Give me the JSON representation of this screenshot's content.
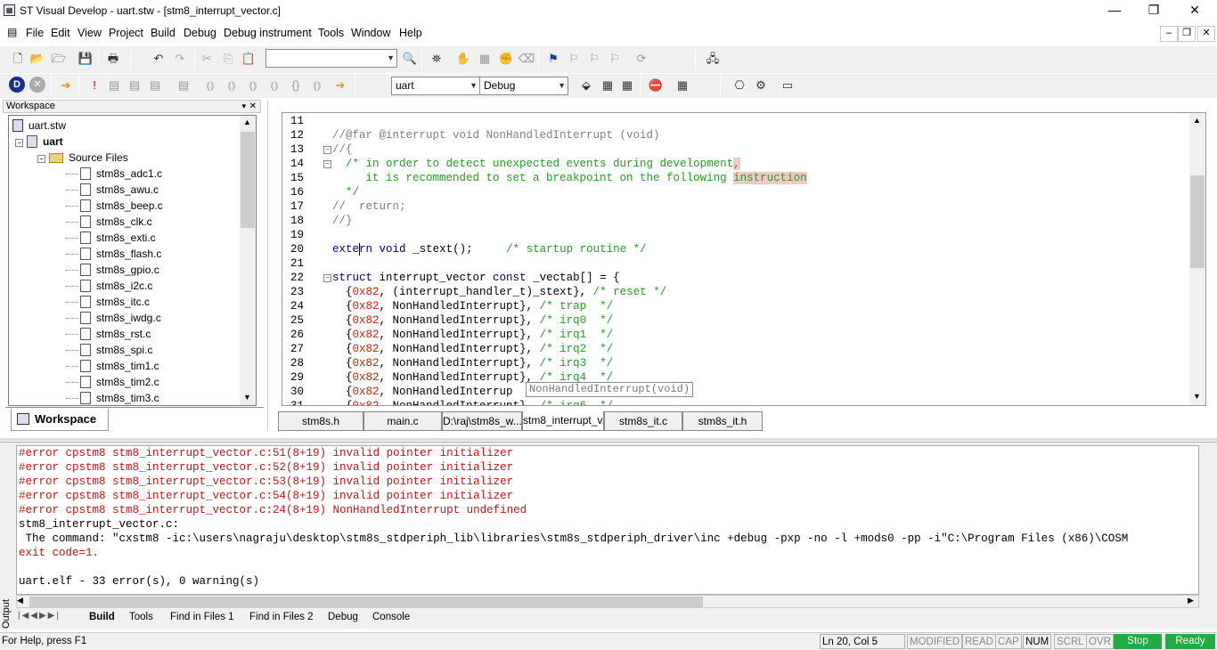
{
  "window": {
    "title": "ST Visual Develop - uart.stw - [stm8_interrupt_vector.c]",
    "minimize": "—",
    "maximize": "❐",
    "close": "✕"
  },
  "menu": [
    "File",
    "Edit",
    "View",
    "Project",
    "Build",
    "Debug",
    "Debug instrument",
    "Tools",
    "Window",
    "Help"
  ],
  "toolbar": {
    "search_value": "",
    "project_select": "uart",
    "config_select": "Debug"
  },
  "workspace": {
    "title": "Workspace",
    "root": "uart.stw",
    "project": "uart",
    "folder": "Source Files",
    "files": [
      "stm8s_adc1.c",
      "stm8s_awu.c",
      "stm8s_beep.c",
      "stm8s_clk.c",
      "stm8s_exti.c",
      "stm8s_flash.c",
      "stm8s_gpio.c",
      "stm8s_i2c.c",
      "stm8s_itc.c",
      "stm8s_iwdg.c",
      "stm8s_rst.c",
      "stm8s_spi.c",
      "stm8s_tim1.c",
      "stm8s_tim2.c",
      "stm8s_tim3.c"
    ],
    "tab_label": "Workspace"
  },
  "editor": {
    "line_numbers": [
      "11",
      "12",
      "13",
      "14",
      "15",
      "16",
      "17",
      "18",
      "19",
      "20",
      "21",
      "22",
      "23",
      "24",
      "25",
      "26",
      "27",
      "28",
      "29",
      "30",
      "31"
    ],
    "tooltip": "NonHandledInterrupt(void)",
    "tabs": [
      "stm8s.h",
      "main.c",
      "D:\\raj\\stm8s_w...",
      "stm8_interrupt_v...",
      "stm8s_it.c",
      "stm8s_it.h"
    ]
  },
  "output": {
    "label": "Output",
    "lines": [
      {
        "text": "#error cpstm8 stm8_interrupt_vector.c:51(8+19) invalid pointer initializer",
        "kind": "error"
      },
      {
        "text": "#error cpstm8 stm8_interrupt_vector.c:52(8+19) invalid pointer initializer",
        "kind": "error"
      },
      {
        "text": "#error cpstm8 stm8_interrupt_vector.c:53(8+19) invalid pointer initializer",
        "kind": "error"
      },
      {
        "text": "#error cpstm8 stm8_interrupt_vector.c:54(8+19) invalid pointer initializer",
        "kind": "error"
      },
      {
        "text": "#error cpstm8 stm8_interrupt_vector.c:24(8+19) NonHandledInterrupt undefined",
        "kind": "error"
      },
      {
        "text": "stm8_interrupt_vector.c:",
        "kind": "normal"
      },
      {
        "text": " The command: \"cxstm8 -ic:\\users\\nagraju\\desktop\\stm8s_stdperiph_lib\\libraries\\stm8s_stdperiph_driver\\inc +debug -pxp -no -l +mods0 -pp -i\"C:\\Program Files (x86)\\COSM",
        "kind": "normal"
      },
      {
        "text": "exit code=1.",
        "kind": "error"
      },
      {
        "text": "",
        "kind": "normal"
      },
      {
        "text": "uart.elf - 33 error(s), 0 warning(s)",
        "kind": "normal"
      }
    ],
    "tabs": [
      "Build",
      "Tools",
      "Find in Files 1",
      "Find in Files 2",
      "Debug",
      "Console"
    ]
  },
  "status": {
    "help": "For Help, press F1",
    "position": "Ln 20, Col 5",
    "modified": "MODIFIED",
    "read": "READ",
    "cap": "CAP",
    "num": "NUM",
    "scrl": "SCRL",
    "ovr": "OVR",
    "stop": "Stop",
    "ready": "Ready",
    "green": "#22aa44"
  }
}
